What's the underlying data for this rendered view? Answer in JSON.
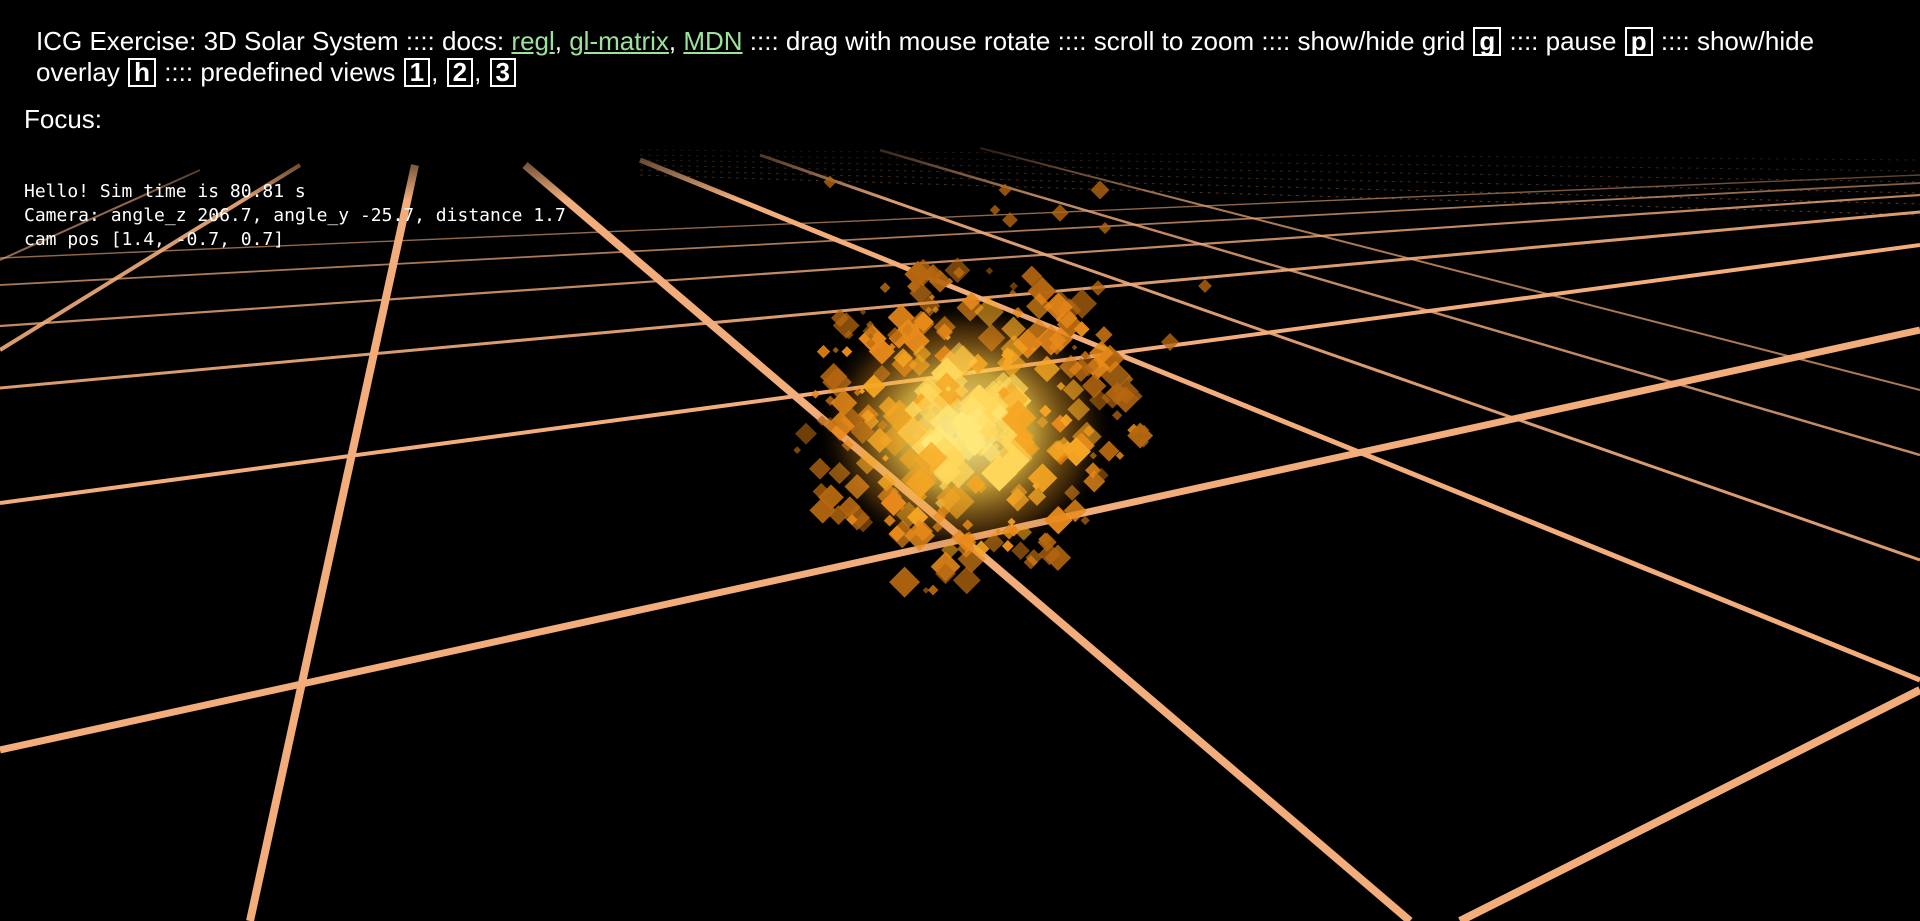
{
  "header": {
    "title": "ICG Exercise: 3D Solar System",
    "sep": ":::: ",
    "docs_label": "docs:",
    "links": [
      {
        "label": "regl"
      },
      {
        "label": "gl-matrix"
      },
      {
        "label": "MDN"
      }
    ],
    "rotate_hint": "drag with mouse rotate",
    "zoom_hint": "scroll to zoom",
    "grid_hint": "show/hide grid",
    "grid_key": "g",
    "pause_hint": "pause",
    "pause_key": "p",
    "overlay_hint": "show/hide overlay",
    "overlay_key": "h",
    "views_hint": "predefined views",
    "view_keys": [
      "1",
      "2",
      "3"
    ]
  },
  "focus": {
    "label": "Focus:"
  },
  "overlay": {
    "line1": "Hello! Sim time is 80.81 s",
    "line2": "Camera: angle_z 206.7, angle_y -25.7, distance 1.7",
    "line3": "cam pos [1.4, -0.7, 0.7]"
  },
  "colors": {
    "background": "#000000",
    "grid": "#f2ad7a",
    "link": "#9ce29c",
    "sun_core": "#ffe87a",
    "sun_mid": "#f5a623",
    "sun_edge": "#b56710"
  }
}
